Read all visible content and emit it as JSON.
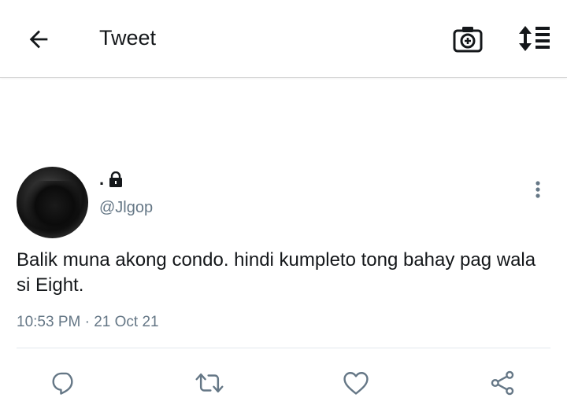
{
  "header": {
    "title": "Tweet",
    "back_icon": "arrow-left-icon",
    "camera_icon": "camera-plus-icon",
    "sort_icon": "sort-list-icon"
  },
  "tweet": {
    "display_name": ".",
    "protected_icon": "lock-icon",
    "handle": "@Jlgop",
    "text": "Balik muna akong condo. hindi kumpleto tong bahay pag wala si Eight.",
    "timestamp": "10:53 PM · 21 Oct 21",
    "more_icon": "more-vertical-icon"
  },
  "actions": [
    {
      "name": "reply",
      "icon": "comment-icon"
    },
    {
      "name": "retweet",
      "icon": "retweet-icon"
    },
    {
      "name": "like",
      "icon": "heart-icon"
    },
    {
      "name": "share",
      "icon": "share-icon"
    }
  ],
  "colors": {
    "text_primary": "#14171a",
    "text_secondary": "#657786",
    "divider": "#e1e8ed",
    "icon": "#657786"
  }
}
